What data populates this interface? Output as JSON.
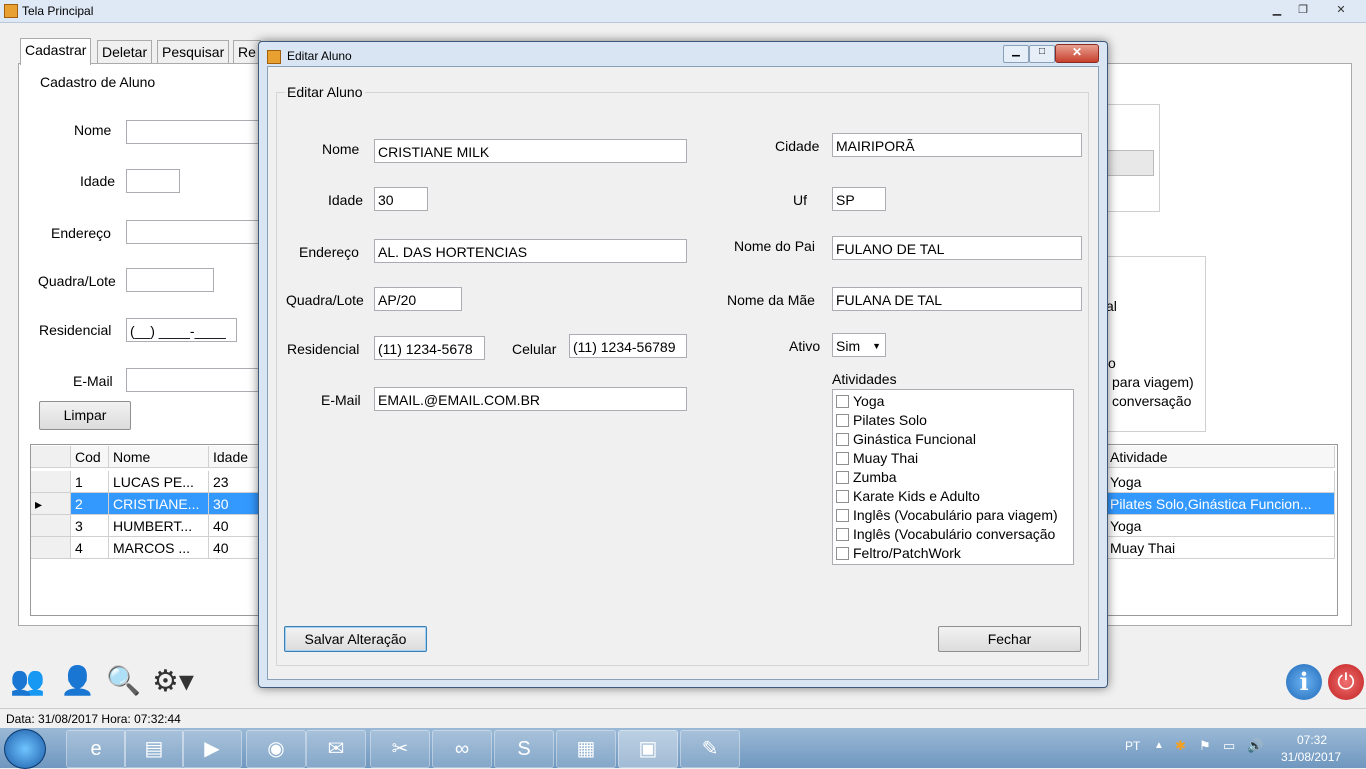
{
  "main": {
    "title": "Tela Principal",
    "tabs": [
      "Cadastrar",
      "Deletar",
      "Pesquisar",
      "Re"
    ],
    "group_title": "Cadastro de Aluno",
    "labels": {
      "nome": "Nome",
      "idade": "Idade",
      "endereco": "Endereço",
      "quadra": "Quadra/Lote",
      "residencial": "Residencial",
      "email": "E-Mail"
    },
    "residencial_mask": "(__) ____-____",
    "clear_button": "Limpar",
    "right_fragments": [
      "al",
      "o",
      "para viagem)",
      "conversação"
    ],
    "grid": {
      "columns": [
        "Cod",
        "Nome",
        "Idade",
        "Atividade"
      ],
      "rows": [
        {
          "cod": "1",
          "nome": "LUCAS PE...",
          "idade": "23",
          "atividade": "Yoga"
        },
        {
          "cod": "2",
          "nome": "CRISTIANE...",
          "idade": "30",
          "atividade": "Pilates Solo,Ginástica Funcion..."
        },
        {
          "cod": "3",
          "nome": "HUMBERT...",
          "idade": "40",
          "atividade": "Yoga"
        },
        {
          "cod": "4",
          "nome": "MARCOS ...",
          "idade": "40",
          "atividade": "Muay Thai"
        }
      ],
      "selected_row": 1
    },
    "status": "Data: 31/08/2017 Hora: 07:32:44"
  },
  "dialog": {
    "title": "Editar Aluno",
    "group_title": "Editar Aluno",
    "labels": {
      "nome": "Nome",
      "idade": "Idade",
      "endereco": "Endereço",
      "quadra": "Quadra/Lote",
      "residencial": "Residencial",
      "celular": "Celular",
      "email": "E-Mail",
      "cidade": "Cidade",
      "uf": "Uf",
      "pai": "Nome do Pai",
      "mae": "Nome da Mãe",
      "ativo": "Ativo",
      "atividades": "Atividades"
    },
    "values": {
      "nome": "CRISTIANE MILK",
      "idade": "30",
      "endereco": "AL. DAS HORTENCIAS",
      "quadra": "AP/20",
      "residencial": "(11) 1234-5678",
      "celular": "(11) 1234-56789",
      "email": "EMAIL.@EMAIL.COM.BR",
      "cidade": "MAIRIPORÃ",
      "uf": "SP",
      "pai": "FULANO DE TAL",
      "mae": "FULANA DE TAL",
      "ativo": "Sim"
    },
    "atividades": [
      "Yoga",
      "Pilates Solo",
      "Ginástica Funcional",
      "Muay Thai",
      "Zumba",
      "Karate Kids e Adulto",
      "Inglês (Vocabulário para viagem)",
      "Inglês (Vocabulário conversação",
      "Feltro/PatchWork"
    ],
    "save_button": "Salvar Alteração",
    "close_button": "Fechar"
  },
  "taskbar": {
    "lang": "PT",
    "time": "07:32",
    "date": "31/08/2017"
  }
}
